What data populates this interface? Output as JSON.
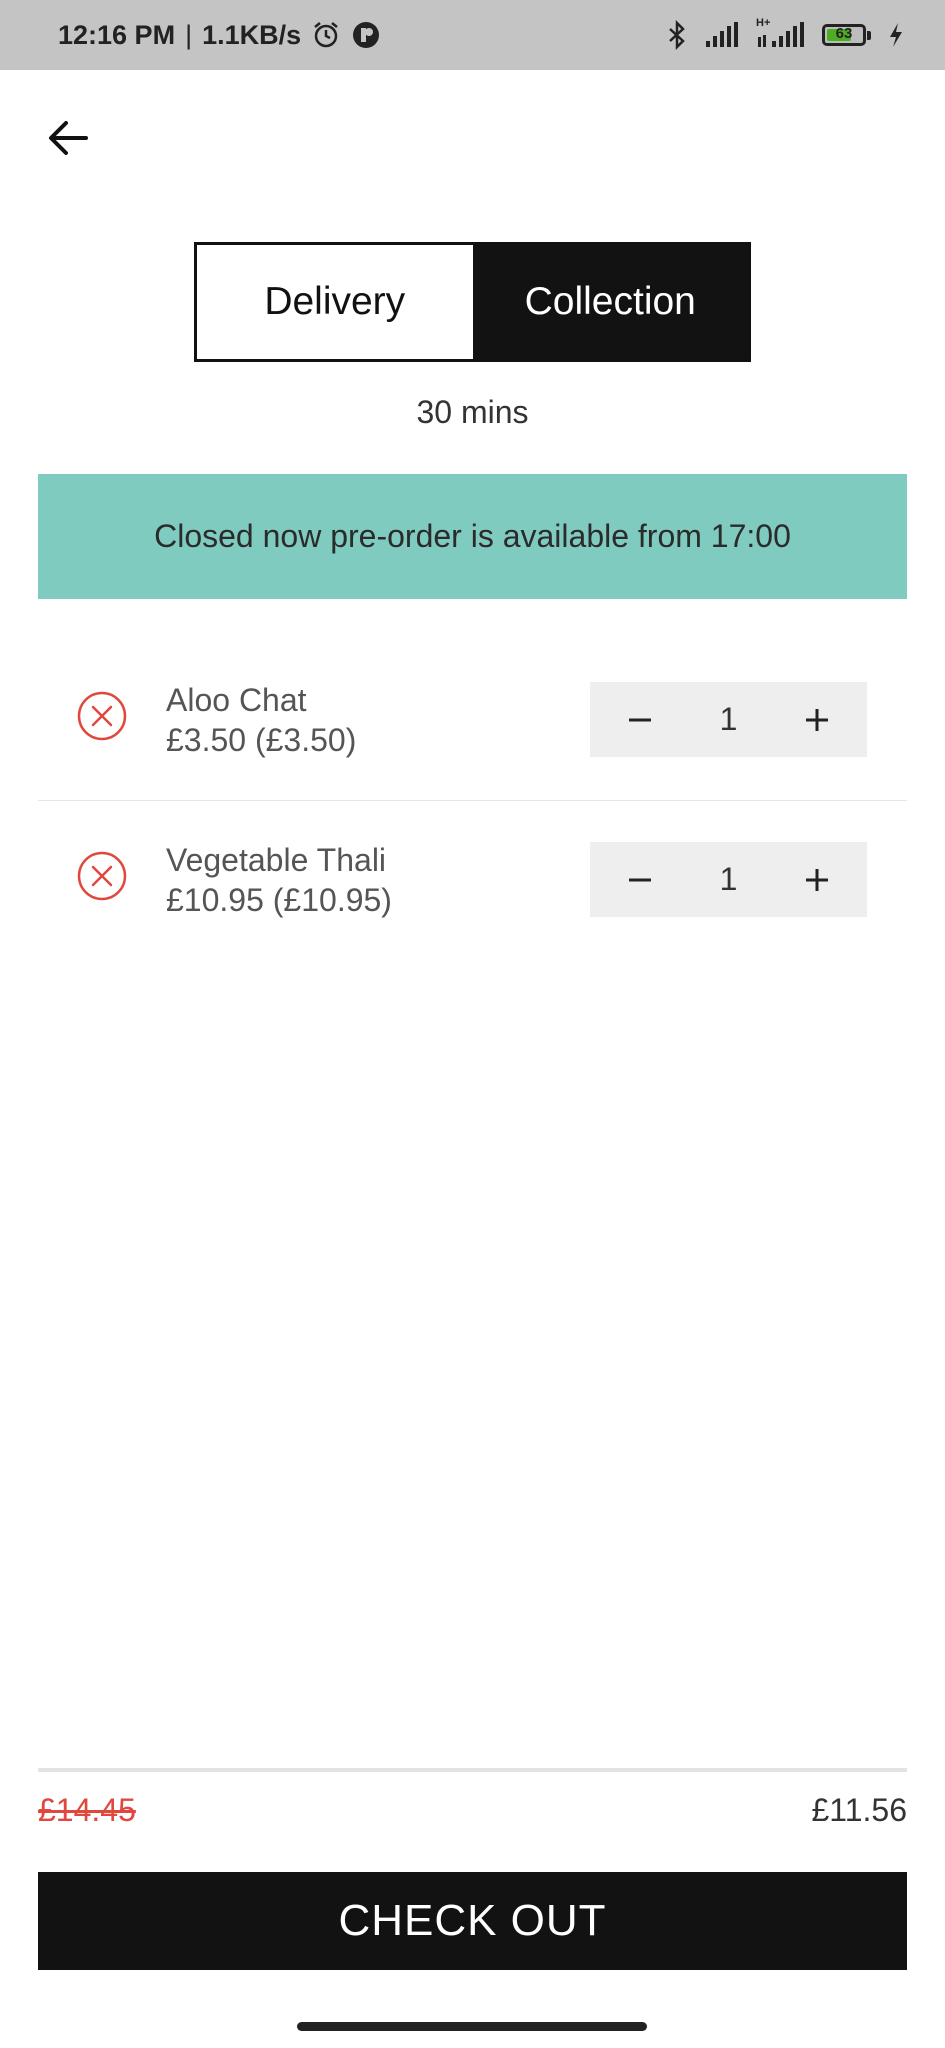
{
  "status_bar": {
    "time": "12:16 PM",
    "separator": "|",
    "speed": "1.1KB/s",
    "network_label": "H+",
    "battery_level": "63"
  },
  "header": {
    "back_icon": "arrow-left-icon"
  },
  "order_type": {
    "options": [
      "Delivery",
      "Collection"
    ],
    "selected": "Collection"
  },
  "eta": "30 mins",
  "notice": {
    "text": "Closed now pre-order is available from 17:00",
    "color": "#80cbc0"
  },
  "cart": {
    "items": [
      {
        "name": "Aloo Chat",
        "price": "£3.50 (£3.50)",
        "quantity": "1"
      },
      {
        "name": "Vegetable Thali",
        "price": "£10.95 (£10.95)",
        "quantity": "1"
      }
    ],
    "remove_icon": "close-circle-icon",
    "remove_color": "#e0483e"
  },
  "totals": {
    "original": "£14.45",
    "discounted": "£11.56"
  },
  "checkout_label": "CHECK OUT"
}
